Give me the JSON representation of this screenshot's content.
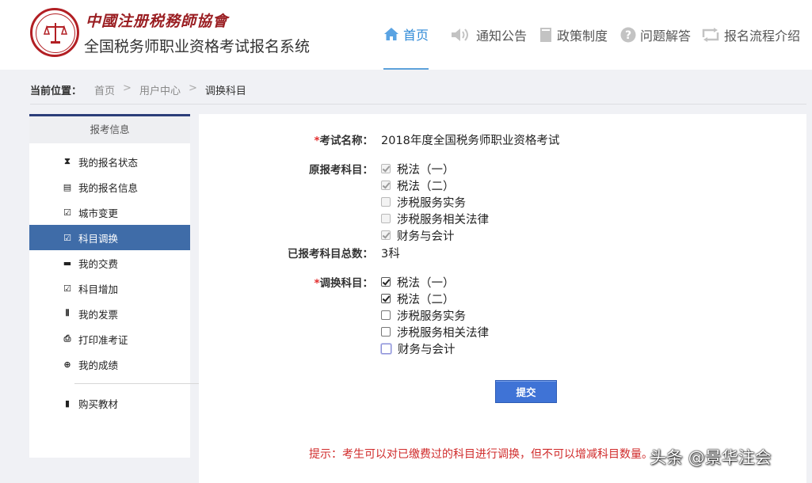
{
  "header": {
    "org_name": "中國注册税務師協會",
    "system_title": "全国税务师职业资格考试报名系统",
    "nav": [
      {
        "label": "首页",
        "icon": "home-icon"
      },
      {
        "label": "通知公告",
        "icon": "speaker-icon"
      },
      {
        "label": "政策制度",
        "icon": "document-icon"
      },
      {
        "label": "问题解答",
        "icon": "question-icon"
      },
      {
        "label": "报名流程介绍",
        "icon": "flow-icon"
      }
    ]
  },
  "breadcrumb": {
    "prefix": "当前位置：",
    "items": [
      "首页",
      "用户中心",
      "调换科目"
    ],
    "separator": ">"
  },
  "sidebar": {
    "title": "报考信息",
    "items": [
      {
        "label": "我的报名状态",
        "icon": "hourglass-icon"
      },
      {
        "label": "我的报名信息",
        "icon": "list-icon"
      },
      {
        "label": "城市变更",
        "icon": "edit-icon"
      },
      {
        "label": "科目调换",
        "icon": "edit-icon"
      },
      {
        "label": "我的交费",
        "icon": "card-icon"
      },
      {
        "label": "科目增加",
        "icon": "edit-icon"
      },
      {
        "label": "我的发票",
        "icon": "barcode-icon"
      },
      {
        "label": "打印准考证",
        "icon": "print-icon"
      },
      {
        "label": "我的成绩",
        "icon": "zoom-icon"
      },
      {
        "label": "购买教材",
        "icon": "book-icon"
      }
    ],
    "active_index": 3
  },
  "form": {
    "exam_name_label": "考试名称：",
    "exam_name_value": "2018年度全国税务师职业资格考试",
    "original_subjects_label": "原报考科目：",
    "original_subjects": [
      {
        "label": "税法（一）",
        "checked": true
      },
      {
        "label": "税法（二）",
        "checked": true
      },
      {
        "label": "涉税服务实务",
        "checked": false
      },
      {
        "label": "涉税服务相关法律",
        "checked": false
      },
      {
        "label": "财务与会计",
        "checked": true
      }
    ],
    "total_label": "已报考科目总数：",
    "total_value": "3科",
    "swap_subjects_label": "调换科目：",
    "swap_subjects": [
      {
        "label": "税法（一）",
        "checked": true
      },
      {
        "label": "税法（二）",
        "checked": true
      },
      {
        "label": "涉税服务实务",
        "checked": false
      },
      {
        "label": "涉税服务相关法律",
        "checked": false
      },
      {
        "label": "财务与会计",
        "checked": false
      }
    ],
    "submit_label": "提交",
    "tip": "提示：考生可以对已缴费过的科目进行调换，但不可以增减科目数量。"
  },
  "watermark": "头条 @景华注会",
  "colors": {
    "brand_red": "#b21f24",
    "nav_active": "#2f8ad7",
    "sidebar_active": "#3f6ca8",
    "button": "#3f73d6",
    "tip_red": "#d02b2b"
  }
}
